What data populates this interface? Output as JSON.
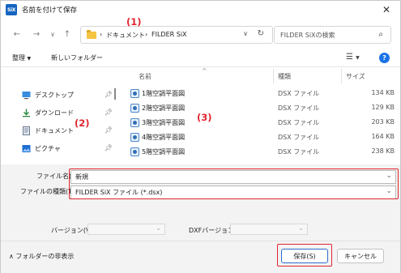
{
  "window": {
    "title": "名前を付けて保存",
    "app_icon_text": "SiX"
  },
  "nav": {
    "breadcrumb": [
      "ドキュメント",
      "FILDER SiX"
    ],
    "search_placeholder": "FILDER SiXの検索"
  },
  "toolbar": {
    "organize": "整理",
    "new_folder": "新しいフォルダー"
  },
  "sidebar": {
    "items": [
      {
        "label": "デスクトップ",
        "icon": "desktop-icon"
      },
      {
        "label": "ダウンロード",
        "icon": "download-icon"
      },
      {
        "label": "ドキュメント",
        "icon": "document-icon"
      },
      {
        "label": "ピクチャ",
        "icon": "picture-icon"
      }
    ]
  },
  "filelist": {
    "columns": {
      "name": "名前",
      "type": "種類",
      "size": "サイズ"
    },
    "rows": [
      {
        "name": "1階空調平面図",
        "type": "DSX ファイル",
        "size": "134 KB"
      },
      {
        "name": "2階空調平面図",
        "type": "DSX ファイル",
        "size": "129 KB"
      },
      {
        "name": "3階空調平面図",
        "type": "DSX ファイル",
        "size": "203 KB"
      },
      {
        "name": "4階空調平面図",
        "type": "DSX ファイル",
        "size": "164 KB"
      },
      {
        "name": "5階空調平面図",
        "type": "DSX ファイル",
        "size": "238 KB"
      }
    ]
  },
  "fields": {
    "filename_label": "ファイル名(N):",
    "filename_value": "新規",
    "filetype_label": "ファイルの種類(T):",
    "filetype_value": "FILDER SiX ファイル (*.dsx)"
  },
  "version": {
    "version_label": "バージョン(V):",
    "dxf_label": "DXFバージョン:"
  },
  "bottom": {
    "hide_folders": "フォルダーの非表示",
    "save": "保存(S)",
    "cancel": "キャンセル"
  },
  "annotations": {
    "a1": "(1)",
    "a2": "(2)",
    "a3": "(3)"
  },
  "colors": {
    "accent": "#e0262e",
    "brand": "#1565c0",
    "help": "#1a73e8"
  }
}
